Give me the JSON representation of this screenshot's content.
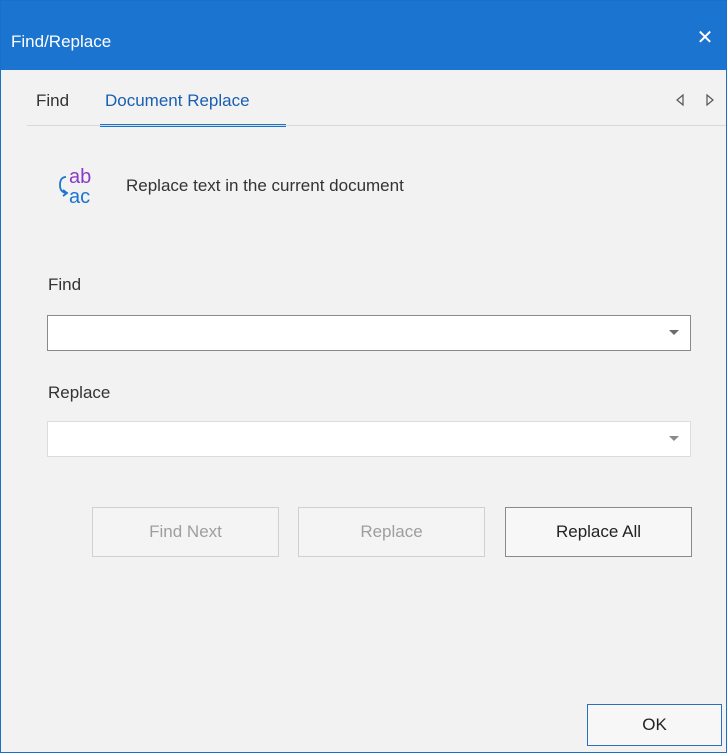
{
  "window": {
    "title": "Find/Replace",
    "close_glyph": "✕",
    "accent_color": "#1b74d0"
  },
  "tabs": {
    "items": [
      {
        "label": "Find",
        "selected": false
      },
      {
        "label": "Document Replace",
        "selected": true
      }
    ],
    "prev_icon": "triangle-left-icon",
    "next_icon": "triangle-right-icon"
  },
  "header": {
    "icon": "replace-text-icon",
    "icon_top_text": "ab",
    "icon_bottom_text": "ac",
    "description": "Replace text in the current document"
  },
  "find": {
    "label": "Find",
    "value": "",
    "placeholder": ""
  },
  "replace": {
    "label": "Replace",
    "value": "",
    "placeholder": ""
  },
  "buttons": {
    "find_next": {
      "label": "Find Next",
      "enabled": false
    },
    "replace": {
      "label": "Replace",
      "enabled": false
    },
    "replace_all": {
      "label": "Replace All",
      "enabled": true
    },
    "ok": {
      "label": "OK",
      "enabled": true
    }
  }
}
